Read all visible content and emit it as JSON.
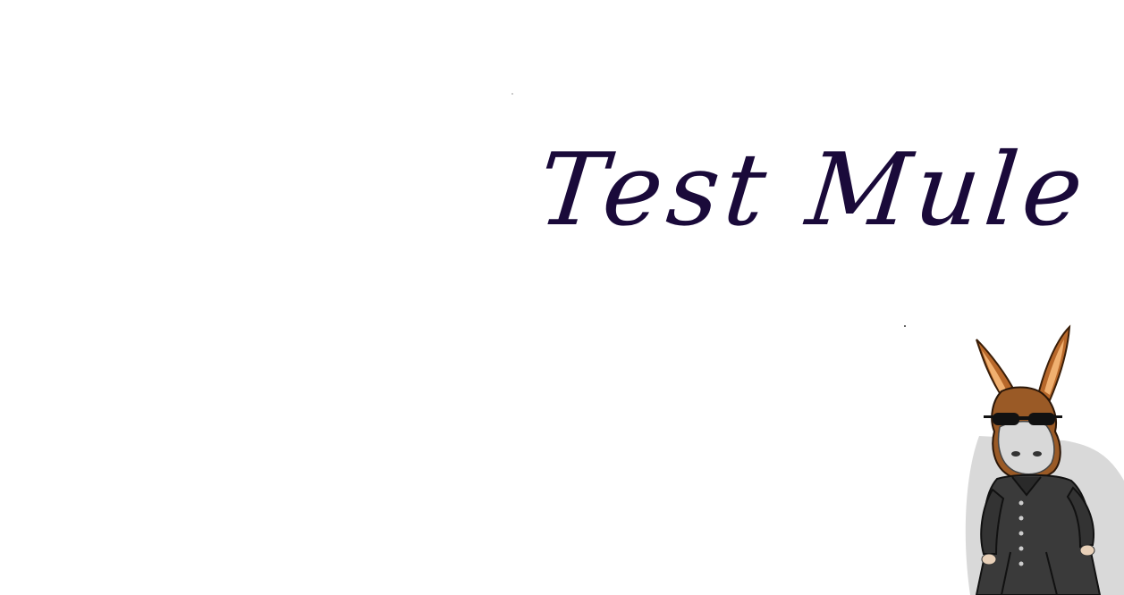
{
  "title": {
    "text": "Test Mule",
    "color": "#1a0a3a"
  },
  "mascot": {
    "icon": "mule-mascot-icon",
    "ear_color": "#b8682a",
    "coat_color": "#3a3a3a",
    "glasses_color": "#111111"
  }
}
